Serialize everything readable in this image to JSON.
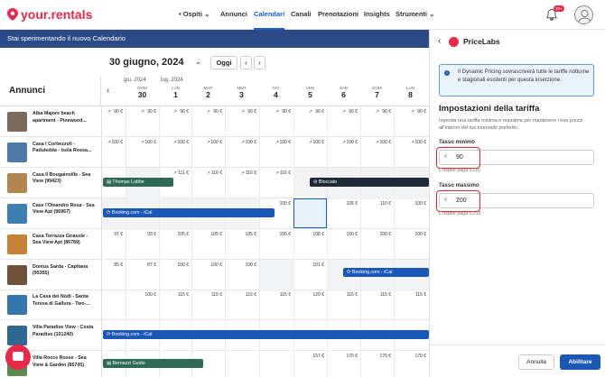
{
  "app": {
    "name": "your.rentals"
  },
  "nav": {
    "items": [
      {
        "label": "Ospiti",
        "has_dot": true,
        "has_dropdown": true
      },
      {
        "label": "Annunci"
      },
      {
        "label": "Calendari",
        "active": true
      },
      {
        "label": "Canali"
      },
      {
        "label": "Prenotazioni"
      },
      {
        "label": "Insights"
      },
      {
        "label": "Strumenti",
        "has_dropdown": true
      }
    ],
    "notifications": "10+",
    "accent": "#1a5fd0",
    "brand": "#e8294a"
  },
  "banner": {
    "text": "Stai sperimentando il nuovo Calendario"
  },
  "calendar": {
    "current_date": "30 giugno, 2024",
    "today_button": "Oggi",
    "prev": "‹",
    "next": "›",
    "list_title": "Annunci",
    "months": [
      {
        "label": "giu, 2024"
      },
      {
        "label": "lug, 2024"
      }
    ],
    "days": [
      {
        "name": "DOM",
        "num": "30"
      },
      {
        "name": "LUN",
        "num": "1"
      },
      {
        "name": "MAR",
        "num": "2"
      },
      {
        "name": "MER",
        "num": "3"
      },
      {
        "name": "GIO",
        "num": "4"
      },
      {
        "name": "VEN",
        "num": "5"
      },
      {
        "name": "SAB",
        "num": "6"
      },
      {
        "name": "DOM",
        "num": "7"
      },
      {
        "name": "LUN",
        "num": "8"
      }
    ],
    "listings": [
      {
        "name": "Alba Majore beach apartment - Pinewood...",
        "thumb": "#7d6a5a",
        "prices": [
          "90 €",
          "90 €",
          "90 €",
          "90 €",
          "90 €",
          "90 €",
          "90 €",
          "90 €",
          "90 €",
          "90 €"
        ],
        "trend": [
          true,
          true,
          true,
          true,
          true,
          true,
          true,
          true,
          true,
          true
        ],
        "gray": []
      },
      {
        "name": "Casa I Corbezzoli - Paduledda - Isola Rossa...",
        "thumb": "#4d7aa8",
        "prices": [
          "100 €",
          "100 €",
          "100 €",
          "100 €",
          "100 €",
          "100 €",
          "100 €",
          "100 €",
          "100 €",
          "100 €"
        ],
        "trend": [
          true,
          true,
          true,
          true,
          true,
          true,
          true,
          true,
          true,
          true
        ],
        "gray": []
      },
      {
        "name": "Casa Il Bougainville - Sea View (99423)",
        "thumb": "#b2874f",
        "prices": [
          "",
          "",
          "111 €",
          "116 €",
          "116 €",
          "116 €",
          "",
          "",
          "",
          ""
        ],
        "trend": [
          false,
          false,
          true,
          true,
          true,
          true,
          false,
          false,
          false,
          false
        ],
        "gray": [
          1,
          6,
          7,
          8,
          9
        ]
      },
      {
        "name": "Case l'Oleandro Rosa - Sea View Apt (96967)",
        "thumb": "#3e7fb2",
        "prices": [
          "",
          "",
          "",
          "",
          "",
          "100 €",
          "105 €",
          "105 €",
          "110 €",
          "100 €"
        ],
        "trend": [
          false,
          false,
          false,
          false,
          false,
          false,
          false,
          false,
          false,
          false
        ],
        "gray": [
          0,
          1,
          2,
          3,
          4
        ]
      },
      {
        "name": "Casa Terrazza Girasole - Sea View Apt (86789)",
        "thumb": "#c78236",
        "prices": [
          "97 €",
          "93 €",
          "105 €",
          "105 €",
          "105 €",
          "105 €",
          "108 €",
          "100 €",
          "100 €",
          "100 €"
        ],
        "trend": [
          false,
          false,
          false,
          false,
          false,
          false,
          false,
          false,
          false,
          false
        ],
        "gray": []
      },
      {
        "name": "Domus Sarda - Capitana (95355)",
        "thumb": "#6f5138",
        "prices": [
          "85 €",
          "87 €",
          "100 €",
          "100 €",
          "100 €",
          "",
          "101 €",
          "",
          "",
          ""
        ],
        "trend": [
          false,
          false,
          false,
          false,
          false,
          false,
          false,
          false,
          false,
          false
        ],
        "gray": [
          5,
          7,
          8,
          9
        ]
      },
      {
        "name": "La Casa dei Nodi - Santa Teresa di Gallura - Two-...",
        "thumb": "#3578ae",
        "prices": [
          "",
          "100 €",
          "115 €",
          "115 €",
          "115 €",
          "115 €",
          "120 €",
          "115 €",
          "115 €",
          "115 €"
        ],
        "trend": [
          false,
          false,
          false,
          false,
          false,
          false,
          false,
          false,
          false,
          false
        ],
        "gray": []
      },
      {
        "name": "Villa Paradise View - Costa Paradiso (101240)",
        "thumb": "#2f6893",
        "prices": [
          "",
          "",
          "",
          "",
          "",
          "",
          "",
          "",
          "",
          ""
        ],
        "trend": [
          false,
          false,
          false,
          false,
          false,
          false,
          false,
          false,
          false,
          false
        ],
        "gray": []
      },
      {
        "name": "Villa Rocce Rosse - Sea View & Garden (85705)",
        "thumb": "#5c8a4e",
        "prices": [
          "",
          "",
          "",
          "",
          "",
          "",
          "157 €",
          "170 €",
          "170 €",
          "170 €"
        ],
        "trend": [
          false,
          false,
          false,
          false,
          false,
          false,
          false,
          false,
          false,
          false
        ],
        "gray": []
      }
    ],
    "reservations": [
      {
        "label": "Thomas Lobbe",
        "type": "green"
      },
      {
        "label": "Bloccato",
        "type": "dark"
      },
      {
        "label": "Booking.com - iCal",
        "type": "blue"
      },
      {
        "label": "Booking.com - iCal",
        "type": "blue"
      },
      {
        "label": "Booking.com - iCal",
        "type": "blue"
      },
      {
        "label": "Bernazzi Guido",
        "type": "green"
      }
    ]
  },
  "panel": {
    "title": "PriceLabs",
    "info": "Il Dynamic Pricing sovrascriverà tutte le tariffe notturne e stagionali esistenti per questa inserzione.",
    "section_title": "Impostazioni della tariffa",
    "section_desc": "Imposta una tariffa minima e massima per mantenere i tuoi prezzi all'interno del tuo intervallo preferito.",
    "min": {
      "label": "Tasso minimo",
      "currency": "€",
      "value": "90",
      "hint": "L'ospite paga €116"
    },
    "max": {
      "label": "Tasso massimo",
      "currency": "€",
      "value": "200",
      "hint": "L'ospite paga €258"
    },
    "cancel": "Annulla",
    "apply": "Abilitare"
  }
}
